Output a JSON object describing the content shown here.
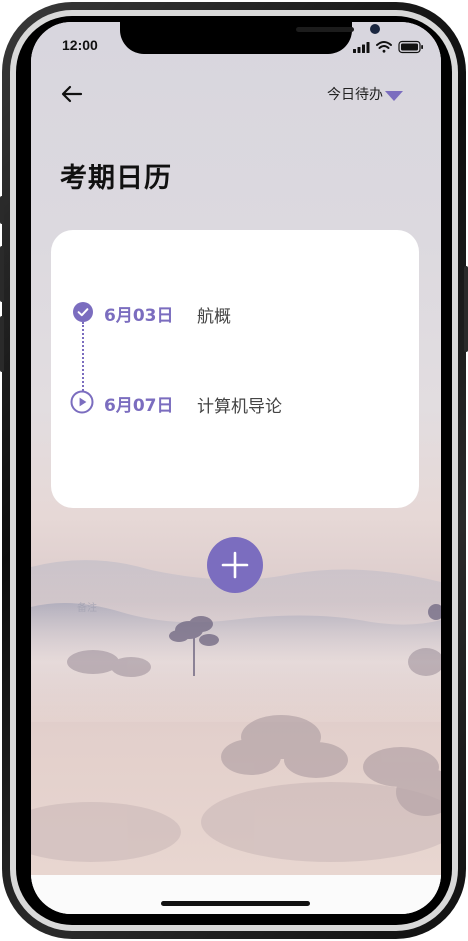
{
  "status_bar": {
    "time": "12:00"
  },
  "header": {
    "back_icon": "arrow-left-icon",
    "today_todo_label": "今日待办",
    "dropdown_icon": "caret-down-icon"
  },
  "page": {
    "title": "考期日历"
  },
  "exams": [
    {
      "date": "6月03日",
      "subject": "航概",
      "status": "completed",
      "icon": "check-circle-icon"
    },
    {
      "date": "6月07日",
      "subject": "计算机导论",
      "status": "upcoming",
      "icon": "play-circle-icon"
    }
  ],
  "add_button": {
    "icon": "plus-icon"
  },
  "background_note": "备注",
  "colors": {
    "accent": "#7b6dbf",
    "card": "#ffffff",
    "title": "#111111"
  }
}
